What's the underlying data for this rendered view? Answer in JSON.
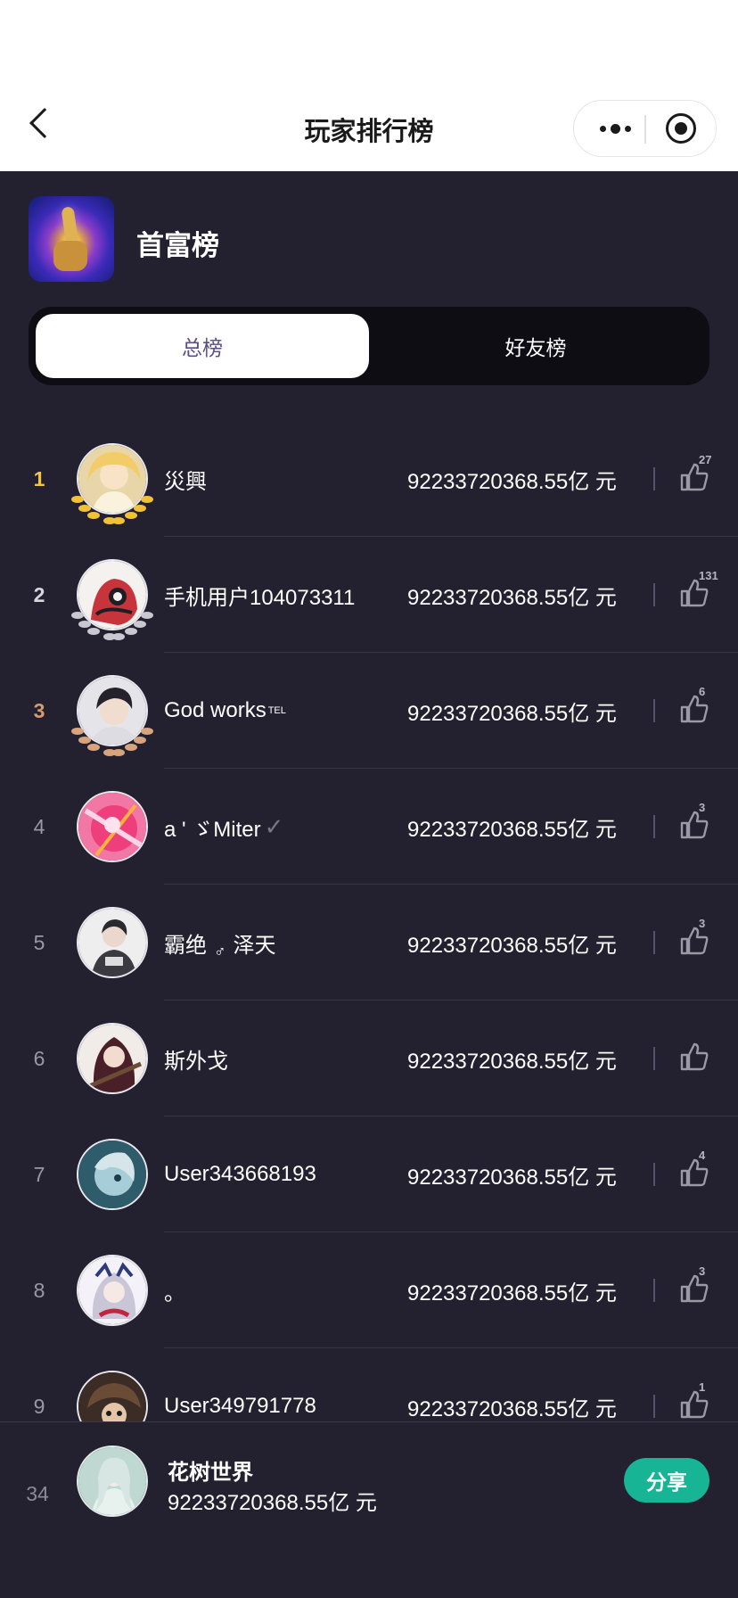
{
  "nav": {
    "title": "玩家排行榜"
  },
  "header": {
    "board_title": "首富榜"
  },
  "tabs": [
    {
      "label": "总榜",
      "active": true
    },
    {
      "label": "好友榜",
      "active": false
    }
  ],
  "ranking": [
    {
      "rank": "1",
      "name": "災興",
      "amount": "92233720368.55亿 元",
      "likes": "27",
      "medal": "gold"
    },
    {
      "rank": "2",
      "name": "手机用户104073311",
      "amount": "92233720368.55亿 元",
      "likes": "131",
      "medal": "silver"
    },
    {
      "rank": "3",
      "name": "God works",
      "name_sup": "TEL",
      "amount": "92233720368.55亿 元",
      "likes": "6",
      "medal": "bronze"
    },
    {
      "rank": "4",
      "name": "a ' ゞMiter",
      "name_suffix": "✓",
      "amount": "92233720368.55亿 元",
      "likes": "3"
    },
    {
      "rank": "5",
      "name": "霸绝",
      "name_gender": "♂",
      "name_tail": "泽天",
      "amount": "92233720368.55亿 元",
      "likes": "3"
    },
    {
      "rank": "6",
      "name": "斯外戈",
      "amount": "92233720368.55亿 元",
      "likes": ""
    },
    {
      "rank": "7",
      "name": "User343668193",
      "amount": "92233720368.55亿 元",
      "likes": "4"
    },
    {
      "rank": "8",
      "name": "。",
      "amount": "92233720368.55亿 元",
      "likes": "3"
    },
    {
      "rank": "9",
      "name": "User349791778",
      "amount": "92233720368.55亿 元",
      "likes": "1"
    }
  ],
  "me": {
    "rank": "34",
    "name": "花树世界",
    "amount": "92233720368.55亿 元",
    "share_label": "分享"
  },
  "colors": {
    "accent": "#17b495",
    "gold": "#f4c63f",
    "silver": "#d6d6dc",
    "bronze": "#d59a73",
    "background": "#23212f"
  }
}
